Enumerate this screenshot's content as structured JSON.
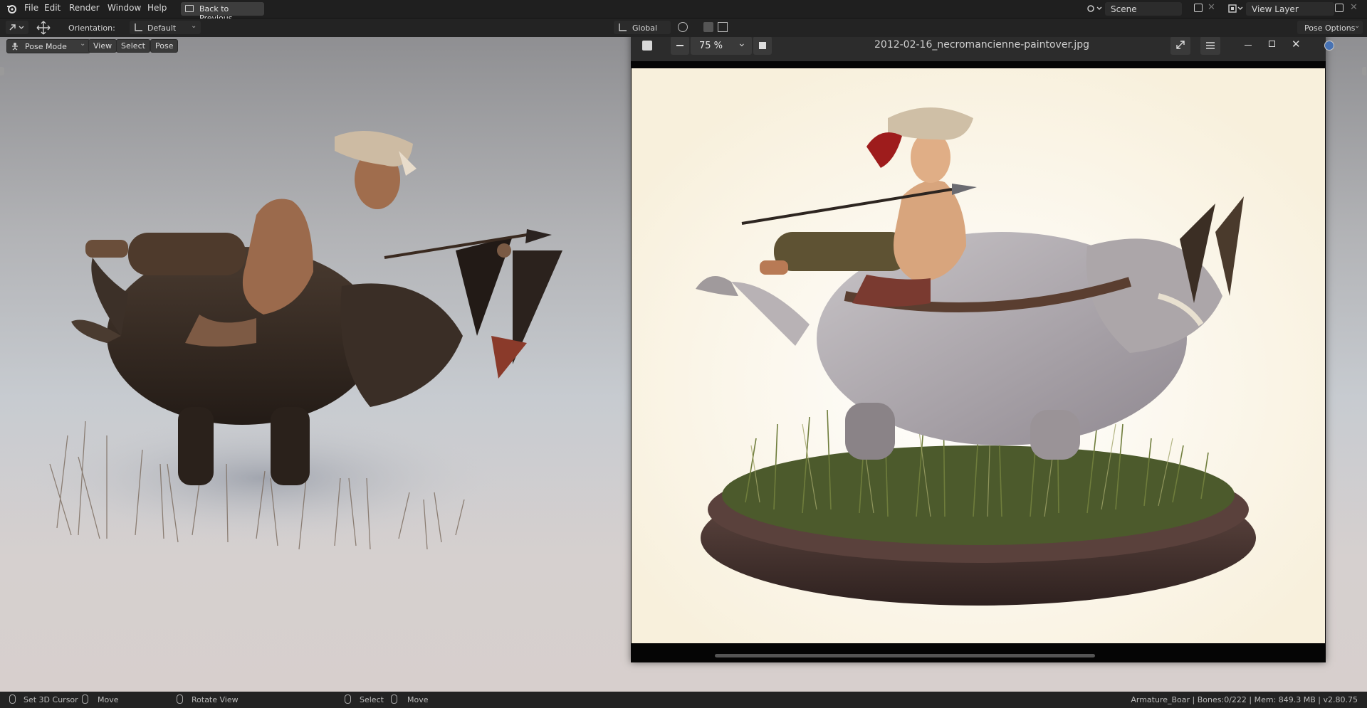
{
  "topbar": {
    "menus": [
      "File",
      "Edit",
      "Render",
      "Window",
      "Help"
    ],
    "back_label": "Back to Previous",
    "scene_label": "Scene",
    "view_layer_label": "View Layer"
  },
  "header": {
    "orientation_label": "Orientation:",
    "orientation_value": "Default",
    "transform_label": "Global",
    "options_label": "Pose Options"
  },
  "viewport": {
    "mode": "Pose Mode",
    "menus": [
      "View",
      "Select",
      "Pose"
    ]
  },
  "viewer": {
    "zoom": "75 %",
    "filename": "2012-02-16_necromancienne-paintover.jpg"
  },
  "statusbar": {
    "set_cursor": "Set 3D Cursor",
    "move1": "Move",
    "rotate": "Rotate View",
    "select": "Select",
    "move2": "Move",
    "info": "Armature_Boar | Bones:0/222  | Mem: 849.3 MB | v2.80.75"
  },
  "colors": {
    "accent": "#4772b3",
    "ui_dark": "#1f1f1f"
  }
}
